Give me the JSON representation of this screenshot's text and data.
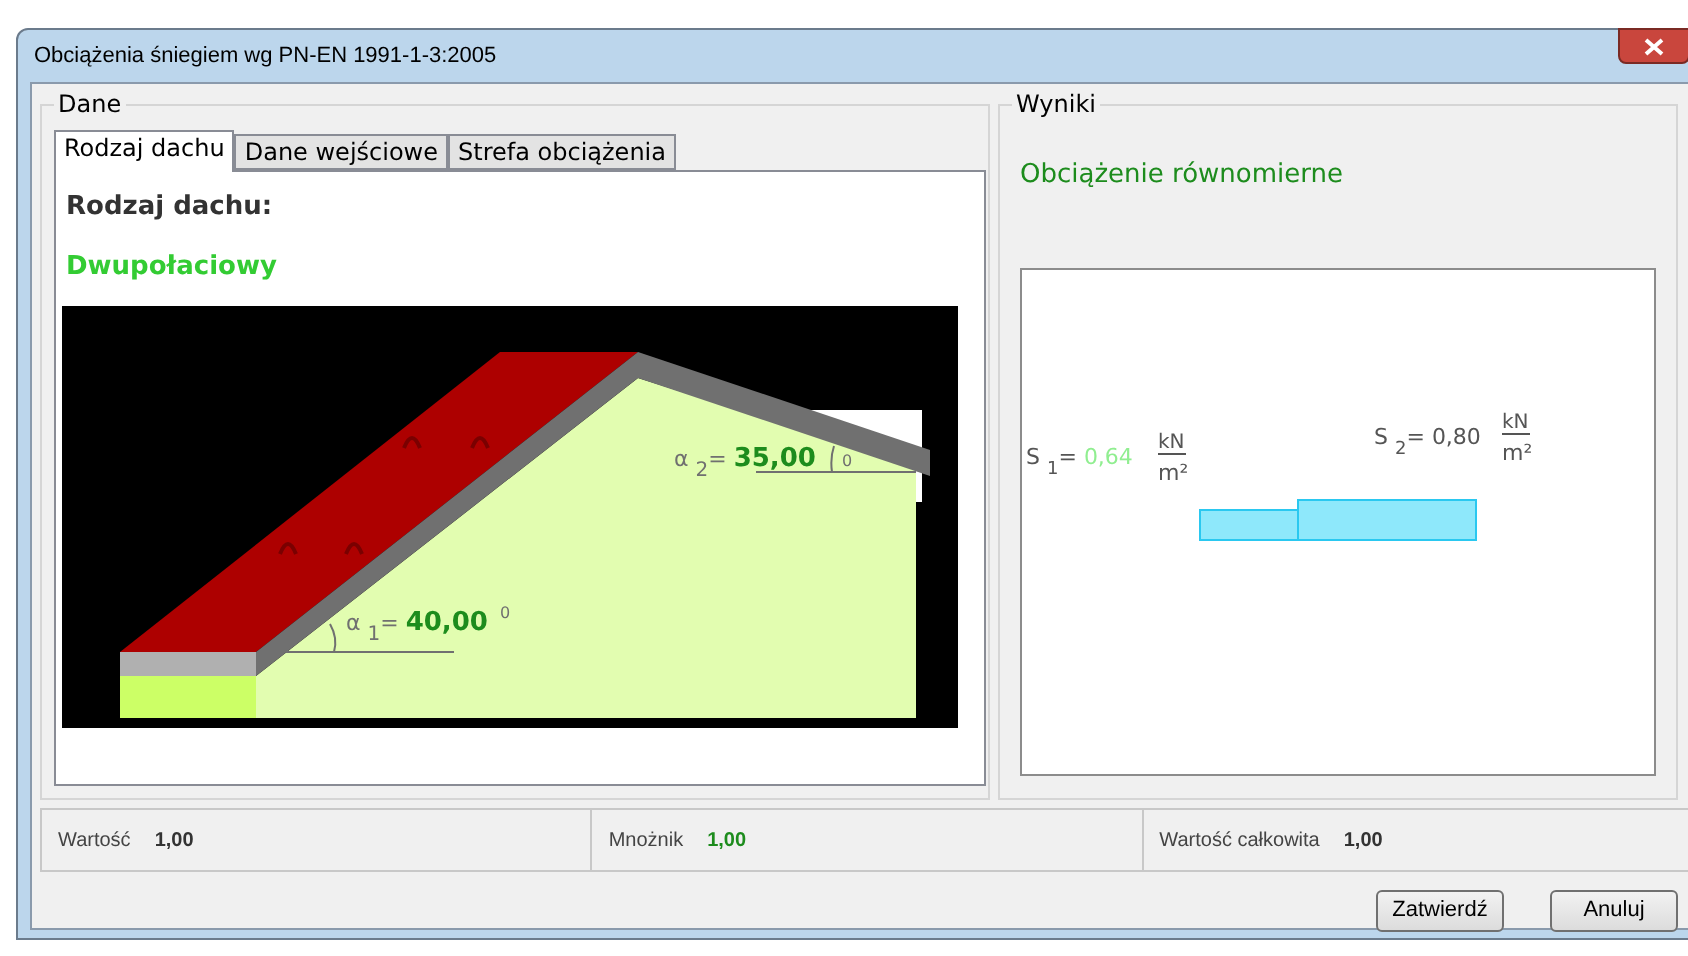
{
  "window": {
    "title": "Obciążenia śniegiem wg PN-EN 1991-1-3:2005"
  },
  "dane": {
    "legend": "Dane",
    "tabs": [
      {
        "label": "Rodzaj dachu",
        "selected": true
      },
      {
        "label": "Dane wejściowe",
        "selected": false
      },
      {
        "label": "Strefa obciążenia",
        "selected": false
      }
    ],
    "heading": "Rodzaj dachu:",
    "roof_type": "Dwupołaciowy",
    "angles": [
      {
        "symbol": "α",
        "index": "1",
        "operator": "=",
        "value": "40,00",
        "unit": "0"
      },
      {
        "symbol": "α",
        "index": "2",
        "operator": "=",
        "value": "35,00",
        "unit": "0"
      }
    ]
  },
  "wyniki": {
    "legend": "Wyniki",
    "load_type": "Obciążenie równomierne",
    "loads": [
      {
        "symbol": "S",
        "index": "1",
        "operator": "=",
        "value": "0,64",
        "unit_top": "kN",
        "unit_bottom": "m²",
        "highlighted": true
      },
      {
        "symbol": "S",
        "index": "2",
        "operator": "=",
        "value": "0,80",
        "unit_top": "kN",
        "unit_bottom": "m²",
        "highlighted": false
      }
    ]
  },
  "status": [
    {
      "label": "Wartość",
      "value": "1,00",
      "highlighted": false
    },
    {
      "label": "Mnożnik",
      "value": "1,00",
      "highlighted": true
    },
    {
      "label": "Wartość całkowita",
      "value": "1,00",
      "highlighted": false
    }
  ],
  "buttons": [
    "Zatwierdź",
    "Anuluj"
  ]
}
